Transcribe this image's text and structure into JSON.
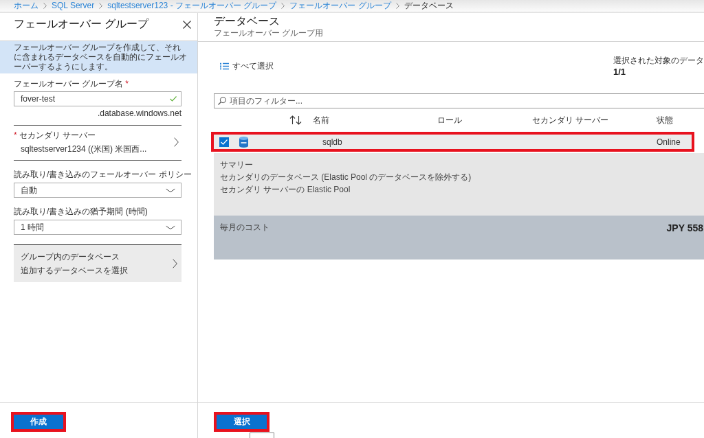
{
  "breadcrumb": [
    {
      "label": "ホーム",
      "current": false
    },
    {
      "label": "SQL Server",
      "current": false
    },
    {
      "label": "sqltestserver123 - フェールオーバー グループ",
      "current": false
    },
    {
      "label": "フェールオーバー グループ",
      "current": false
    },
    {
      "label": "データベース",
      "current": true
    }
  ],
  "left_panel": {
    "title": "フェールオーバー グループ",
    "info": "フェールオーバー グループを作成して、それに含まれるデータベースを自動的にフェールオーバーするようにします。",
    "fields": [
      {
        "kind": "text",
        "label": "フェールオーバー グループ名",
        "required_mark": "*",
        "value": "fover-test",
        "valid": true,
        "suffix": ".database.windows.net"
      },
      {
        "kind": "picker",
        "label": "セカンダリ サーバー",
        "required_mark": "*",
        "value": "sqltestserver1234 ((米国) 米国西..."
      },
      {
        "kind": "select",
        "label": "読み取り/書き込みのフェールオーバー ポリシー",
        "value": "自動"
      },
      {
        "kind": "select",
        "label": "読み取り/書き込みの猶予期間 (時間)",
        "value": "1 時間"
      },
      {
        "kind": "picker_box",
        "label": "グループ内のデータベース",
        "value": "追加するデータベースを選択"
      }
    ],
    "button": {
      "label": "作成",
      "highlighted": true
    }
  },
  "right_panel": {
    "title": "データベース",
    "subtitle": "フェールオーバー グループ用",
    "select_all": "すべて選択",
    "selection": {
      "label": "選択された対象のデータ",
      "count": "1/1"
    },
    "filter": {
      "placeholder": "項目のフィルター..."
    },
    "table": {
      "columns": [
        "名前",
        "ロール",
        "セカンダリ サーバー",
        "状態"
      ],
      "rows": [
        {
          "name": "sqldb",
          "status": "Online",
          "checked": true,
          "highlighted": true
        }
      ]
    },
    "summary": [
      "サマリー",
      "セカンダリのデータベース (Elastic Pool のデータベースを除外する)",
      "セカンダリ サーバーの Elastic Pool"
    ],
    "cost": {
      "label": "毎月のコスト",
      "value": "JPY 558"
    },
    "button": {
      "label": "選択",
      "highlighted": true
    }
  }
}
